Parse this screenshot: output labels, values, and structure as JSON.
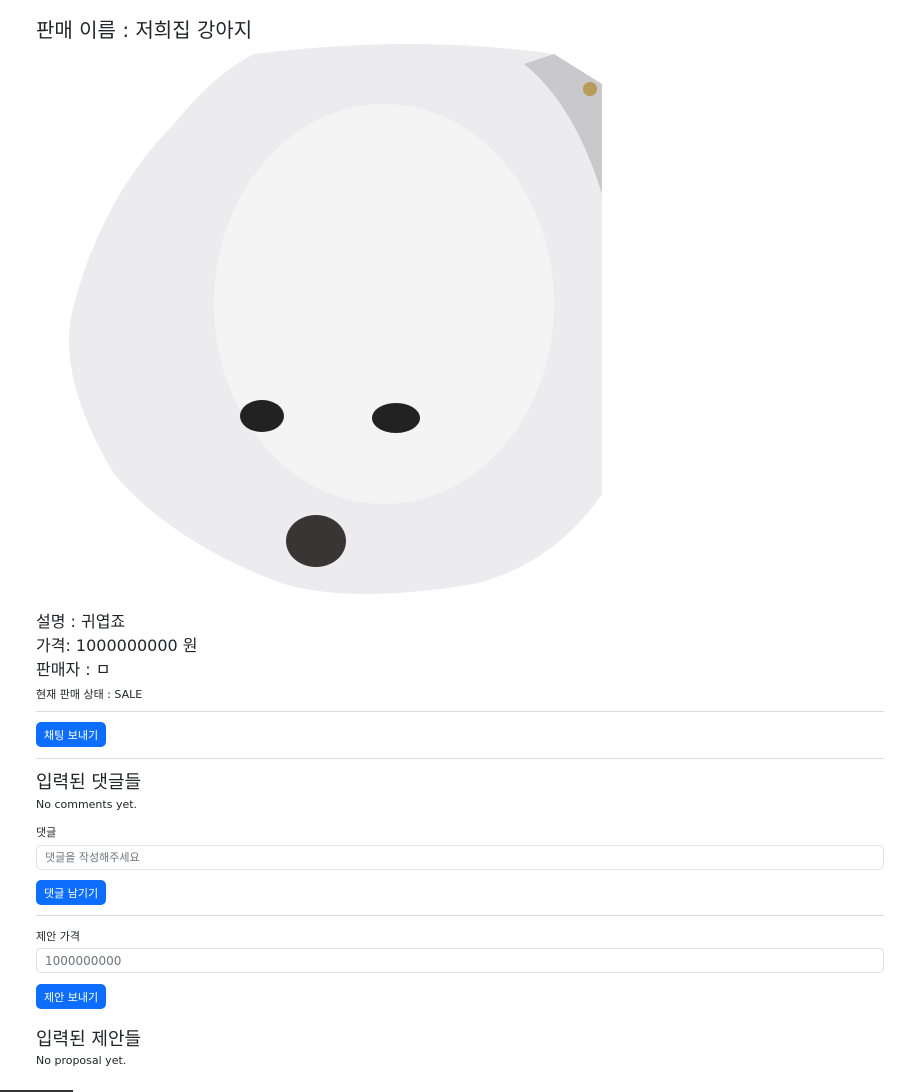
{
  "title": "판매 이름 : 저희집 강아지",
  "description": "설명 : 귀엽죠",
  "price": "가격: 1000000000 원",
  "seller": "판매자 : ㅁ",
  "status": "현재 판매 상태 : SALE",
  "chat_button": "채팅 보내기",
  "comments": {
    "heading": "입력된 댓글들",
    "empty": "No comments yet.",
    "label": "댓글",
    "placeholder": "댓글을 작성해주세요",
    "submit": "댓글 남기기"
  },
  "proposal": {
    "label": "제안 가격",
    "placeholder": "1000000000",
    "submit": "제안 보내기",
    "heading": "입력된 제안들",
    "empty": "No proposal yet."
  }
}
